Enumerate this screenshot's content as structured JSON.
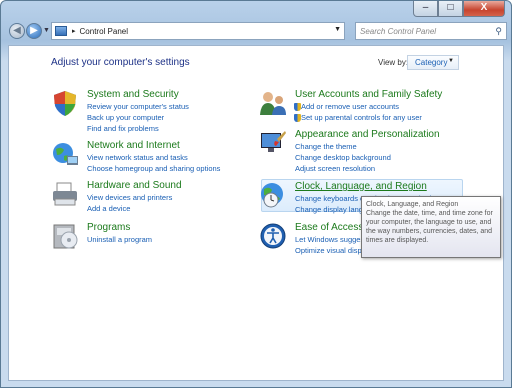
{
  "window": {
    "title_buttons": {
      "minimize": "–",
      "maximize": "□",
      "close": "X"
    }
  },
  "navigation": {
    "breadcrumb": "Control Panel",
    "search_placeholder": "Search Control Panel"
  },
  "main": {
    "heading": "Adjust your computer's settings",
    "view_by_label": "View by:",
    "view_by_value": "Category"
  },
  "left_categories": [
    {
      "title": "System and Security",
      "links": [
        "Review your computer's status",
        "Back up your computer",
        "Find and fix problems"
      ]
    },
    {
      "title": "Network and Internet",
      "links": [
        "View network status and tasks",
        "Choose homegroup and sharing options"
      ]
    },
    {
      "title": "Hardware and Sound",
      "links": [
        "View devices and printers",
        "Add a device"
      ]
    },
    {
      "title": "Programs",
      "links": [
        "Uninstall a program"
      ]
    }
  ],
  "right_categories": [
    {
      "title": "User Accounts and Family Safety",
      "links": [
        "Add or remove user accounts",
        "Set up parental controls for any user"
      ]
    },
    {
      "title": "Appearance and Personalization",
      "links": [
        "Change the theme",
        "Change desktop background",
        "Adjust screen resolution"
      ]
    },
    {
      "title": "Clock, Language, and Region",
      "links": [
        "Change keyboards or other input methods",
        "Change display language"
      ]
    },
    {
      "title": "Ease of Access",
      "links": [
        "Let Windows suggest settings",
        "Optimize visual display"
      ]
    }
  ],
  "tooltip": {
    "title": "Clock, Language, and Region",
    "text": "Change the date, time, and time zone for your computer, the language to use, and the way numbers, currencies, dates, and times are displayed."
  }
}
